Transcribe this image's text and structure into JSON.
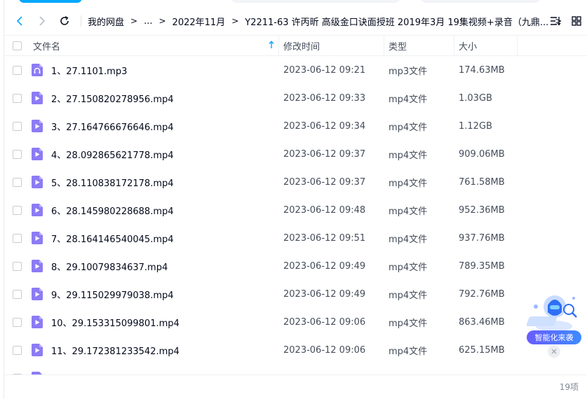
{
  "toolbar": {
    "breadcrumbs": [
      "我的网盘",
      "...",
      "2022年11月",
      "Y2211-63 许丙昕 高级金口诀面授班 2019年3月 19集视频+录音（九鼎..."
    ],
    "crumb_separator": ">"
  },
  "columns": {
    "name": "文件名",
    "date": "修改时间",
    "type": "类型",
    "size": "大小"
  },
  "files": [
    {
      "name": "1、27.1101.mp3",
      "date": "2023-06-12 09:21",
      "type": "mp3文件",
      "size": "174.63MB",
      "icon": "audio-file-icon"
    },
    {
      "name": "2、27.150820278956.mp4",
      "date": "2023-06-12 09:33",
      "type": "mp4文件",
      "size": "1.03GB",
      "icon": "video-file-icon"
    },
    {
      "name": "3、27.164766676646.mp4",
      "date": "2023-06-12 09:34",
      "type": "mp4文件",
      "size": "1.12GB",
      "icon": "video-file-icon"
    },
    {
      "name": "4、28.092865621778.mp4",
      "date": "2023-06-12 09:37",
      "type": "mp4文件",
      "size": "909.06MB",
      "icon": "video-file-icon"
    },
    {
      "name": "5、28.110838172178.mp4",
      "date": "2023-06-12 09:37",
      "type": "mp4文件",
      "size": "761.58MB",
      "icon": "video-file-icon"
    },
    {
      "name": "6、28.145980228688.mp4",
      "date": "2023-06-12 09:48",
      "type": "mp4文件",
      "size": "952.36MB",
      "icon": "video-file-icon"
    },
    {
      "name": "7、28.164146540045.mp4",
      "date": "2023-06-12 09:51",
      "type": "mp4文件",
      "size": "937.76MB",
      "icon": "video-file-icon"
    },
    {
      "name": "8、29.10079834637.mp4",
      "date": "2023-06-12 09:49",
      "type": "mp4文件",
      "size": "789.35MB",
      "icon": "video-file-icon"
    },
    {
      "name": "9、29.115029979038.mp4",
      "date": "2023-06-12 09:49",
      "type": "mp4文件",
      "size": "792.76MB",
      "icon": "video-file-icon"
    },
    {
      "name": "10、29.153315099801.mp4",
      "date": "2023-06-12 09:06",
      "type": "mp4文件",
      "size": "863.46MB",
      "icon": "video-file-icon"
    },
    {
      "name": "11、29.172381233542.mp4",
      "date": "2023-06-12 09:06",
      "type": "mp4文件",
      "size": "625.15MB",
      "icon": "video-file-icon"
    }
  ],
  "footer": {
    "count": "19项"
  },
  "assistant": {
    "label": "智能化来袭"
  },
  "colors": {
    "accent": "#06a7ff",
    "file_icon": "#8c7bf5",
    "badge": "#5b6cff"
  }
}
